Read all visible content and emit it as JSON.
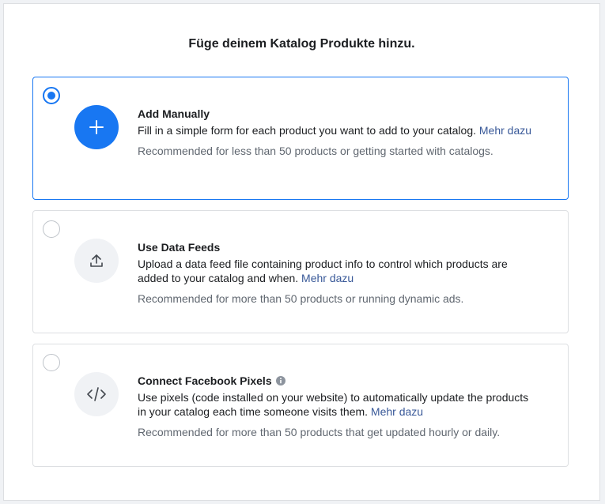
{
  "page": {
    "title": "Füge deinem Katalog Produkte hinzu."
  },
  "options": [
    {
      "title": "Add Manually",
      "description": "Fill in a simple form for each product you want to add to your catalog.",
      "link": "Mehr dazu",
      "recommendation": "Recommended for less than 50 products or getting started with catalogs.",
      "selected": true,
      "icon": "plus-icon"
    },
    {
      "title": "Use Data Feeds",
      "description": "Upload a data feed file containing product info to control which products are added to your catalog and when.",
      "link": "Mehr dazu",
      "recommendation": "Recommended for more than 50 products or running dynamic ads.",
      "selected": false,
      "icon": "upload-icon"
    },
    {
      "title": "Connect Facebook Pixels",
      "description": "Use pixels (code installed on your website) to automatically update the products in your catalog each time someone visits them.",
      "link": "Mehr dazu",
      "recommendation": "Recommended for more than 50 products that get updated hourly or daily.",
      "selected": false,
      "icon": "code-icon",
      "info_icon": "info-icon"
    }
  ],
  "colors": {
    "accent": "#1877f2",
    "link": "#385898",
    "muted": "#606770",
    "border": "#dddfe2"
  }
}
